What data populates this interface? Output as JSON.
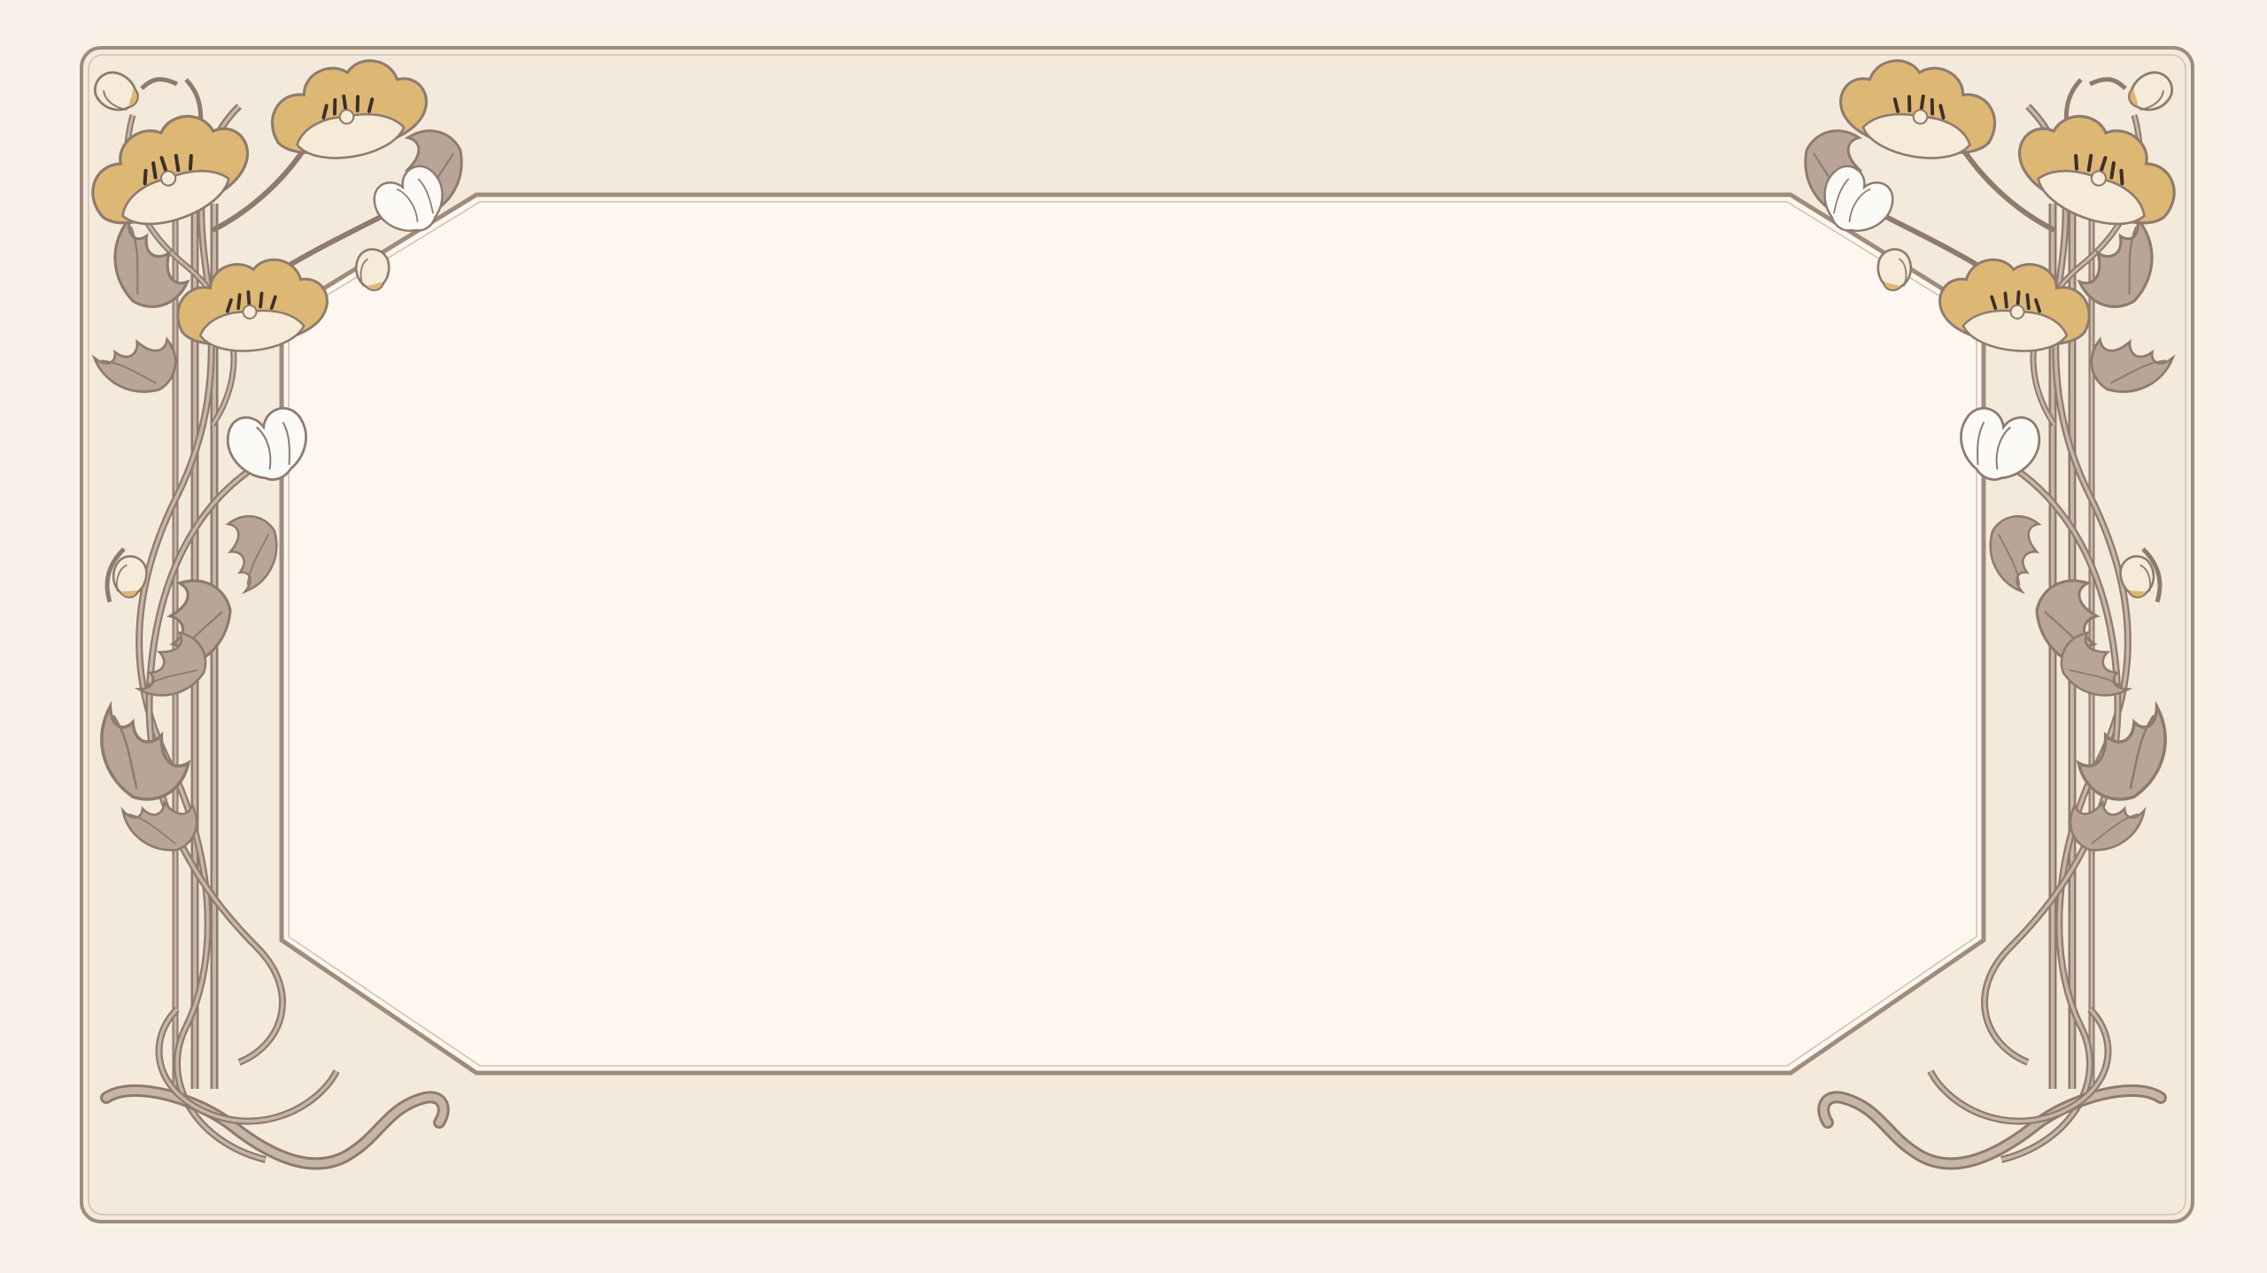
{
  "colors": {
    "background": "#f8f1e7",
    "frame_fill": "#f3eadb",
    "frame_line": "#a08c7d",
    "panel_fill": "#fdf7f0",
    "stem": "#b6a396",
    "stem_dark": "#8f7b6e",
    "leaf": "#b9a597",
    "poppy_gold": "#ddb774",
    "poppy_cream": "#f6ebd9",
    "poppy_white": "#fbfaf6",
    "stamen": "#3b2f2b"
  },
  "ornament": {
    "style": "art-nouveau-poppy-frame",
    "motifs": [
      "poppy-flower",
      "poppy-bud",
      "acanthus-leaf",
      "whiplash-stem"
    ]
  }
}
